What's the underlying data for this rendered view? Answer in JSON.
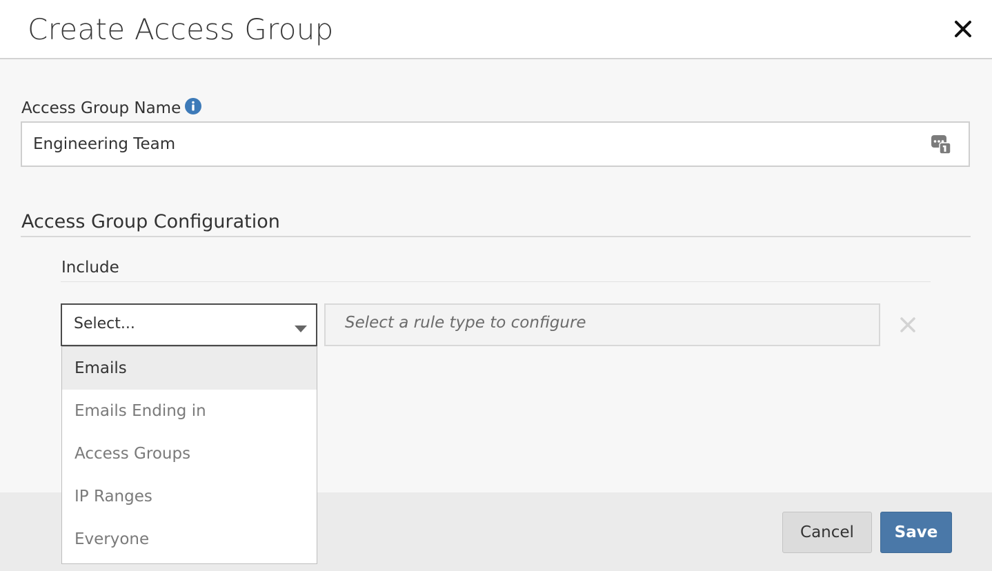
{
  "dialog": {
    "title": "Create Access Group"
  },
  "name_field": {
    "label": "Access Group Name",
    "value": "Engineering Team",
    "info_icon": "info-icon",
    "autofill_icon": "password-manager-icon"
  },
  "configuration": {
    "title": "Access Group Configuration",
    "include_title": "Include",
    "rule_select": {
      "placeholder": "Select...",
      "options": [
        "Emails",
        "Emails Ending in",
        "Access Groups",
        "IP Ranges",
        "Everyone"
      ],
      "highlighted": "Emails"
    },
    "rule_config_placeholder": "Select a rule type to configure"
  },
  "footer": {
    "cancel_label": "Cancel",
    "save_label": "Save"
  },
  "colors": {
    "primary": "#4a78a8",
    "info": "#3d7ab8"
  }
}
